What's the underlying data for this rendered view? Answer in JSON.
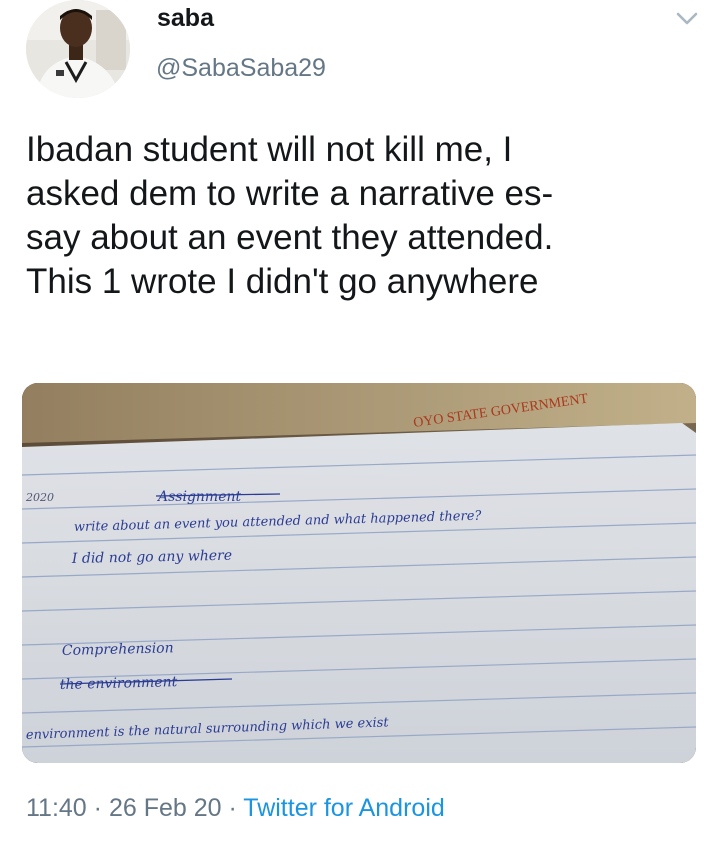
{
  "user": {
    "display_name": "saba",
    "handle": "@SabaSaba29"
  },
  "tweet": {
    "text_lines": [
      "Ibadan student will not kill me, I",
      "asked dem to write a narrative es-",
      "say about an event they attended.",
      "This 1 wrote I didn't go anywhere"
    ]
  },
  "photo": {
    "header_print": "OYO STATE GOVERNMENT",
    "margin_note": "2020",
    "lines": [
      "Assignment",
      "write about an event you attended and what happened there?",
      "I did not go any where",
      "Comprehension",
      "the environment",
      "environment is the natural surrounding which we exist"
    ]
  },
  "meta": {
    "time": "11:40",
    "separator": " · ",
    "date": "26 Feb 20",
    "source": "Twitter for Android"
  },
  "colors": {
    "link": "#1b95e0",
    "secondary_text": "#657786",
    "primary_text": "#14171a",
    "ink": "#2c3f9a"
  },
  "icons": {
    "menu": "chevron-down-icon"
  }
}
